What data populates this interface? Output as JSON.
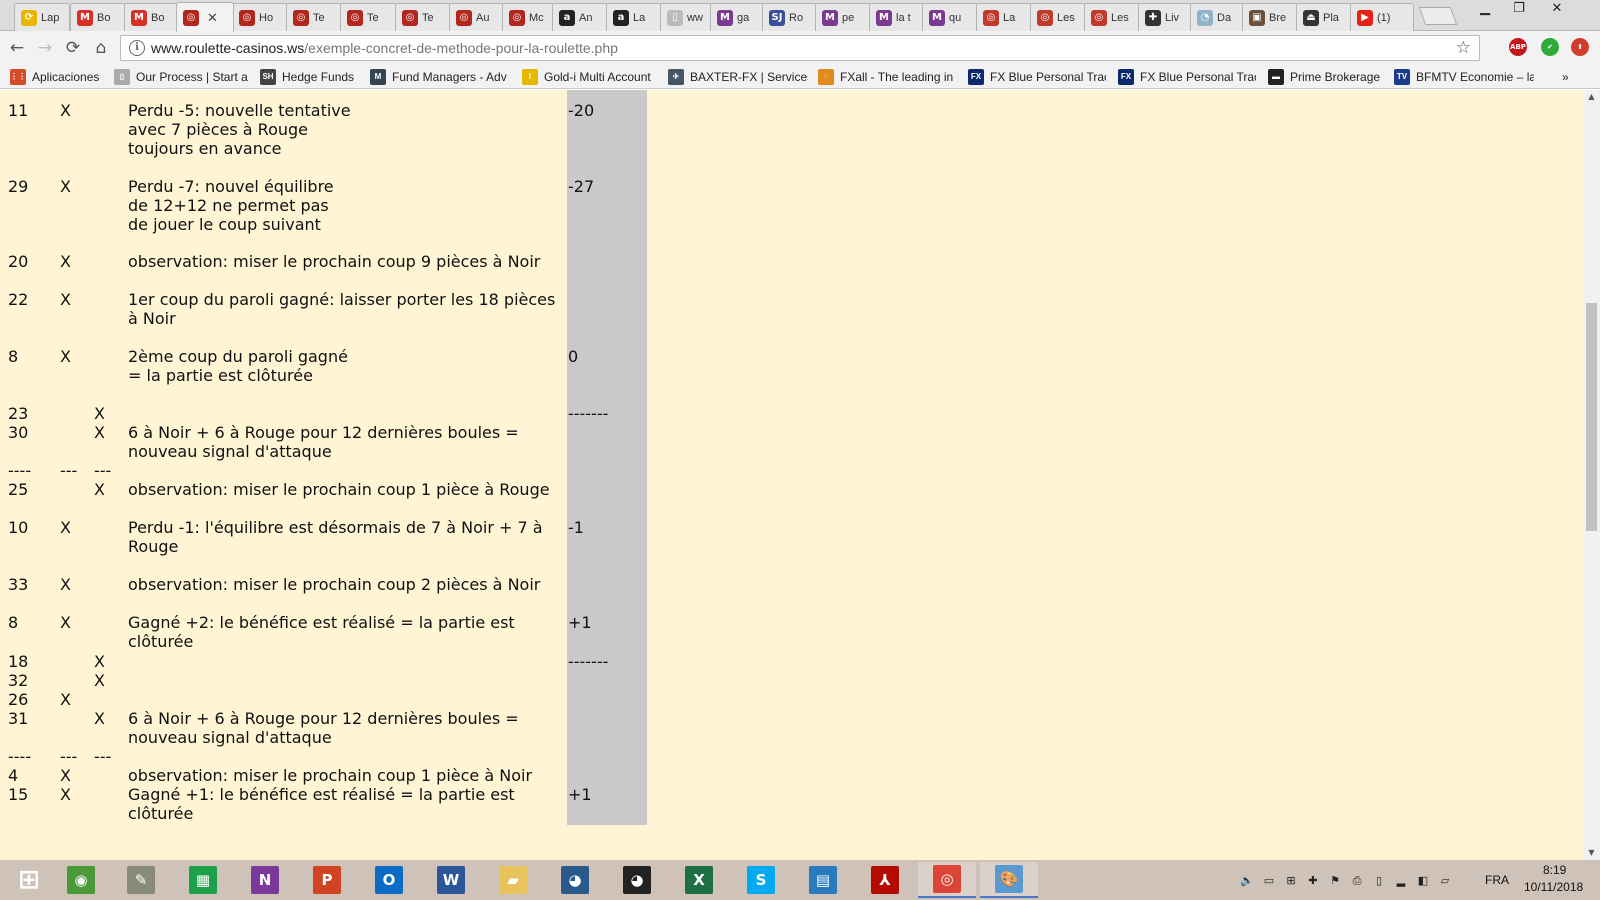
{
  "browser": {
    "tabs": [
      {
        "label": "Lap",
        "icon": "reload-favicon-icon",
        "color": "#e8b600",
        "glyph": "⟳"
      },
      {
        "label": "Bo",
        "icon": "gmail-icon",
        "color": "#d93025",
        "glyph": "M"
      },
      {
        "label": "Bo",
        "icon": "gmail-icon",
        "color": "#d93025",
        "glyph": "M"
      },
      {
        "label": "",
        "icon": "roulette-icon",
        "color": "#b3261e",
        "glyph": "◎"
      },
      {
        "label": "Ho",
        "icon": "roulette-icon",
        "color": "#b3261e",
        "glyph": "◎"
      },
      {
        "label": "Te",
        "icon": "roulette-icon",
        "color": "#b3261e",
        "glyph": "◎"
      },
      {
        "label": "Te",
        "icon": "roulette-icon",
        "color": "#b3261e",
        "glyph": "◎"
      },
      {
        "label": "Te",
        "icon": "roulette-icon",
        "color": "#b3261e",
        "glyph": "◎"
      },
      {
        "label": "Au",
        "icon": "roulette-icon",
        "color": "#b3261e",
        "glyph": "◎"
      },
      {
        "label": "Mc",
        "icon": "roulette-icon",
        "color": "#b3261e",
        "glyph": "◎"
      },
      {
        "label": "An",
        "icon": "amazon-icon",
        "color": "#222222",
        "glyph": "a"
      },
      {
        "label": "La",
        "icon": "amazon-icon",
        "color": "#222222",
        "glyph": "a"
      },
      {
        "label": "ww",
        "icon": "document-icon",
        "color": "#bbbbbb",
        "glyph": "▯"
      },
      {
        "label": "ga",
        "icon": "magazine-m-icon",
        "color": "#7a3a8f",
        "glyph": "M"
      },
      {
        "label": "Ro",
        "icon": "sj-icon",
        "color": "#3a4f9a",
        "glyph": "SJ"
      },
      {
        "label": "pe",
        "icon": "magazine-m-icon",
        "color": "#7a3a8f",
        "glyph": "M"
      },
      {
        "label": "la t",
        "icon": "magazine-m-icon",
        "color": "#7a3a8f",
        "glyph": "M"
      },
      {
        "label": "qu",
        "icon": "magazine-m-icon",
        "color": "#7a3a8f",
        "glyph": "M"
      },
      {
        "label": "La",
        "icon": "casino-icon",
        "color": "#c0392b",
        "glyph": "◎"
      },
      {
        "label": "Les",
        "icon": "casino-icon",
        "color": "#c0392b",
        "glyph": "◎"
      },
      {
        "label": "Les",
        "icon": "casino-icon",
        "color": "#c0392b",
        "glyph": "◎"
      },
      {
        "label": "Liv",
        "icon": "plus-icon",
        "color": "#333333",
        "glyph": "✚"
      },
      {
        "label": "Da",
        "icon": "cat-icon",
        "color": "#8fb3c9",
        "glyph": "◔"
      },
      {
        "label": "Bre",
        "icon": "photo-icon",
        "color": "#6b4f3a",
        "glyph": "▣"
      },
      {
        "label": "Pla",
        "icon": "platform-icon",
        "color": "#333333",
        "glyph": "⏏"
      },
      {
        "label": "(1)",
        "icon": "youtube-icon",
        "color": "#e62117",
        "glyph": "▶"
      }
    ],
    "close_glyph": "✕",
    "url_host": "www.roulette-casinos.ws",
    "url_path": "/exemple-concret-de-methode-pour-la-roulette.php",
    "extensions": [
      {
        "name": "adblock-icon",
        "label": "ABP",
        "color": "#c4161c"
      },
      {
        "name": "check-extension-icon",
        "label": "✔",
        "color": "#2faa39"
      },
      {
        "name": "upload-extension-icon",
        "label": "⬆",
        "color": "#d33b2a"
      }
    ],
    "bookmarks": [
      {
        "label": "Aplicaciones",
        "icon": "apps-grid-icon",
        "color": "#d44c2a",
        "glyph": "⋮⋮"
      },
      {
        "label": "Our Process | Start a",
        "icon": "page-icon",
        "color": "#aaaaaa",
        "glyph": "▯"
      },
      {
        "label": "Hedge Funds",
        "icon": "sh-icon",
        "color": "#444444",
        "glyph": "SH"
      },
      {
        "label": "Fund Managers - Adv",
        "icon": "fm-icon",
        "color": "#334455",
        "glyph": "M"
      },
      {
        "label": "Gold-i Multi Account",
        "icon": "gold-i-icon",
        "color": "#e6b800",
        "glyph": "i"
      },
      {
        "label": "BAXTER-FX | Services",
        "icon": "baxter-icon",
        "color": "#445566",
        "glyph": "✈"
      },
      {
        "label": "FXall - The leading in",
        "icon": "fxall-icon",
        "color": "#e38a1f",
        "glyph": "◌"
      },
      {
        "label": "FX Blue Personal Trac",
        "icon": "fxblue-icon",
        "color": "#0a2a6b",
        "glyph": "FX"
      },
      {
        "label": "FX Blue Personal Trac",
        "icon": "fxblue-icon",
        "color": "#0a2a6b",
        "glyph": "FX"
      },
      {
        "label": "Prime Brokerage",
        "icon": "prime-icon",
        "color": "#222222",
        "glyph": "▬"
      },
      {
        "label": "BFMTV Economie – la",
        "icon": "bfmtv-icon",
        "color": "#1a3c8a",
        "glyph": "TV"
      }
    ],
    "more_bookmarks": "»"
  },
  "table_rows": [
    {
      "num": "11",
      "x1": "X",
      "x2": "",
      "comment": [
        "Perdu -5: nouvelle tentative",
        "avec 7 pièces à Rouge",
        "toujours en avance"
      ],
      "amount": "-20"
    },
    {
      "num": "29",
      "x1": "X",
      "x2": "",
      "comment": [
        "Perdu -7: nouvel équilibre",
        "de 12+12 ne permet pas",
        "de jouer le coup suivant"
      ],
      "amount": "-27"
    },
    {
      "num": "20",
      "x1": "X",
      "x2": "",
      "comment": [
        "observation: miser le prochain coup 9 pièces à Noir"
      ],
      "amount": ""
    },
    {
      "num": "22",
      "x1": "X",
      "x2": "",
      "comment": [
        "1er coup du paroli gagné: laisser porter les 18 pièces à Noir"
      ],
      "amount": ""
    },
    {
      "num": "8",
      "x1": "X",
      "x2": "",
      "comment": [
        "2ème coup du paroli gagné",
        "= la partie est clôturée"
      ],
      "amount": "0"
    },
    {
      "num": "23",
      "x1": "",
      "x2": "X",
      "comment": [],
      "amount": "-------"
    },
    {
      "num": "30",
      "x1": "",
      "x2": "X",
      "comment": [
        "6 à Noir + 6 à Rouge pour 12 dernières boules = nouveau signal d'attaque"
      ],
      "amount": ""
    },
    {
      "num": "----",
      "x1": "---",
      "x2": "---",
      "comment": [],
      "amount": ""
    },
    {
      "num": "25",
      "x1": "",
      "x2": "X",
      "comment": [
        "observation: miser le prochain coup 1 pièce à Rouge"
      ],
      "amount": ""
    },
    {
      "num": "10",
      "x1": "X",
      "x2": "",
      "comment": [
        "Perdu -1: l'équilibre est désormais de 7 à Noir + 7 à Rouge"
      ],
      "amount": "-1"
    },
    {
      "num": "33",
      "x1": "X",
      "x2": "",
      "comment": [
        "observation: miser le prochain coup 2 pièces à Noir"
      ],
      "amount": ""
    },
    {
      "num": "8",
      "x1": "X",
      "x2": "",
      "comment": [
        "Gagné +2: le bénéfice est réalisé = la partie est clôturée"
      ],
      "amount": "+1"
    },
    {
      "num": "18",
      "x1": "",
      "x2": "X",
      "comment": [],
      "amount": "-------"
    },
    {
      "num": "32",
      "x1": "",
      "x2": "X",
      "comment": [],
      "amount": ""
    },
    {
      "num": "26",
      "x1": "X",
      "x2": "",
      "comment": [],
      "amount": ""
    },
    {
      "num": "31",
      "x1": "",
      "x2": "X",
      "comment": [
        "6 à Noir + 6 à Rouge pour 12 dernières boules = nouveau signal d'attaque"
      ],
      "amount": ""
    },
    {
      "num": "----",
      "x1": "---",
      "x2": "---",
      "comment": [],
      "amount": ""
    },
    {
      "num": "4",
      "x1": "X",
      "x2": "",
      "comment": [
        "observation: miser le prochain coup 1 pièce à Noir"
      ],
      "amount": ""
    },
    {
      "num": "15",
      "x1": "X",
      "x2": "",
      "comment": [
        "Gagné +1: le bénéfice est réalisé = la partie est clôturée"
      ],
      "amount": "+1"
    }
  ],
  "taskbar": {
    "apps": [
      {
        "name": "start-button",
        "icon": "windows-logo-icon",
        "color": "#ffffff",
        "glyph": "⊞"
      },
      {
        "name": "taskbar-app-chromium",
        "icon": "colorful-orb-icon",
        "color": "#4a9a3a",
        "glyph": "◉"
      },
      {
        "name": "taskbar-app-notes",
        "icon": "notes-icon",
        "color": "#8a8a7a",
        "glyph": "✎"
      },
      {
        "name": "taskbar-app-store",
        "icon": "store-icon",
        "color": "#1aa14a",
        "glyph": "▦"
      },
      {
        "name": "taskbar-app-onenote",
        "icon": "onenote-icon",
        "color": "#7a3a9a",
        "glyph": "N"
      },
      {
        "name": "taskbar-app-powerpoint",
        "icon": "powerpoint-icon",
        "color": "#d04423",
        "glyph": "P"
      },
      {
        "name": "taskbar-app-outlook",
        "icon": "outlook-icon",
        "color": "#0a6cc4",
        "glyph": "O"
      },
      {
        "name": "taskbar-app-word",
        "icon": "word-icon",
        "color": "#2b579a",
        "glyph": "W"
      },
      {
        "name": "taskbar-app-explorer",
        "icon": "folder-icon",
        "color": "#e8c25a",
        "glyph": "▰"
      },
      {
        "name": "taskbar-app-owl",
        "icon": "owl-icon",
        "color": "#2a5a8a",
        "glyph": "◕"
      },
      {
        "name": "taskbar-app-owl-dark",
        "icon": "owl-dark-icon",
        "color": "#222222",
        "glyph": "◕"
      },
      {
        "name": "taskbar-app-excel",
        "icon": "excel-icon",
        "color": "#1d7044",
        "glyph": "X"
      },
      {
        "name": "taskbar-app-skype",
        "icon": "skype-icon",
        "color": "#00a9f0",
        "glyph": "S"
      },
      {
        "name": "taskbar-app-remote",
        "icon": "remote-desktop-icon",
        "color": "#2a7ac0",
        "glyph": "▤"
      },
      {
        "name": "taskbar-app-acrobat",
        "icon": "acrobat-icon",
        "color": "#b30b00",
        "glyph": "⅄"
      },
      {
        "name": "taskbar-app-chrome",
        "icon": "chrome-icon",
        "color": "#db4437",
        "glyph": "◎"
      },
      {
        "name": "taskbar-app-paint",
        "icon": "paint-icon",
        "color": "#5a9ad0",
        "glyph": "🎨"
      }
    ],
    "language": "FRA",
    "time": "8:19",
    "date": "10/11/2018"
  }
}
